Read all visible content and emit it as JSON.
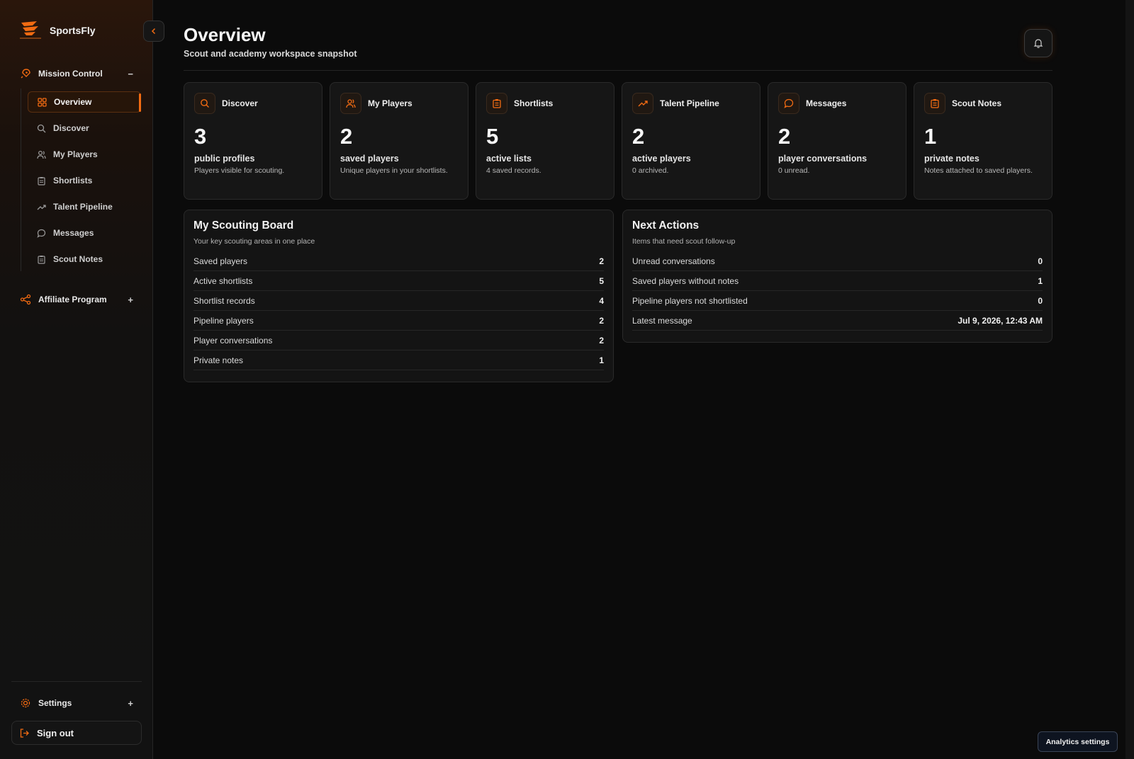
{
  "brand": {
    "name": "SportsFly"
  },
  "sidebar": {
    "group_mission": {
      "label": "Mission Control",
      "toggle": "−"
    },
    "items": [
      {
        "label": "Overview",
        "icon": "grid-icon",
        "active": true
      },
      {
        "label": "Discover",
        "icon": "search-icon"
      },
      {
        "label": "My Players",
        "icon": "users-icon"
      },
      {
        "label": "Shortlists",
        "icon": "clipboard-icon"
      },
      {
        "label": "Talent Pipeline",
        "icon": "trending-up-icon"
      },
      {
        "label": "Messages",
        "icon": "message-icon"
      },
      {
        "label": "Scout Notes",
        "icon": "clipboard-icon"
      }
    ],
    "group_affiliate": {
      "label": "Affiliate Program",
      "toggle": "+"
    },
    "group_settings": {
      "label": "Settings",
      "toggle": "+"
    },
    "sign_out": "Sign out"
  },
  "header": {
    "title": "Overview",
    "subtitle": "Scout and academy workspace snapshot"
  },
  "stats": [
    {
      "label": "Discover",
      "icon": "search-icon",
      "value": "3",
      "caption": "public profiles",
      "desc": "Players visible for scouting."
    },
    {
      "label": "My Players",
      "icon": "users-icon",
      "value": "2",
      "caption": "saved players",
      "desc": "Unique players in your shortlists."
    },
    {
      "label": "Shortlists",
      "icon": "clipboard-icon",
      "value": "5",
      "caption": "active lists",
      "desc": "4 saved records."
    },
    {
      "label": "Talent Pipeline",
      "icon": "trending-up-icon",
      "value": "2",
      "caption": "active players",
      "desc": "0 archived."
    },
    {
      "label": "Messages",
      "icon": "message-icon",
      "value": "2",
      "caption": "player conversations",
      "desc": "0 unread."
    },
    {
      "label": "Scout Notes",
      "icon": "clipboard-icon",
      "value": "1",
      "caption": "private notes",
      "desc": "Notes attached to saved players."
    }
  ],
  "scouting_board": {
    "title": "My Scouting Board",
    "subtitle": "Your key scouting areas in one place",
    "rows": [
      {
        "label": "Saved players",
        "value": "2"
      },
      {
        "label": "Active shortlists",
        "value": "5"
      },
      {
        "label": "Shortlist records",
        "value": "4"
      },
      {
        "label": "Pipeline players",
        "value": "2"
      },
      {
        "label": "Player conversations",
        "value": "2"
      },
      {
        "label": "Private notes",
        "value": "1"
      }
    ]
  },
  "next_actions": {
    "title": "Next Actions",
    "subtitle": "Items that need scout follow-up",
    "rows": [
      {
        "label": "Unread conversations",
        "value": "0"
      },
      {
        "label": "Saved players without notes",
        "value": "1"
      },
      {
        "label": "Pipeline players not shortlisted",
        "value": "0"
      },
      {
        "label": "Latest message",
        "value": "Jul 9, 2026, 12:43 AM"
      }
    ]
  },
  "analytics_button": "Analytics settings",
  "colors": {
    "accent": "#f26b12",
    "background": "#0b0b0b",
    "card": "#161616"
  }
}
